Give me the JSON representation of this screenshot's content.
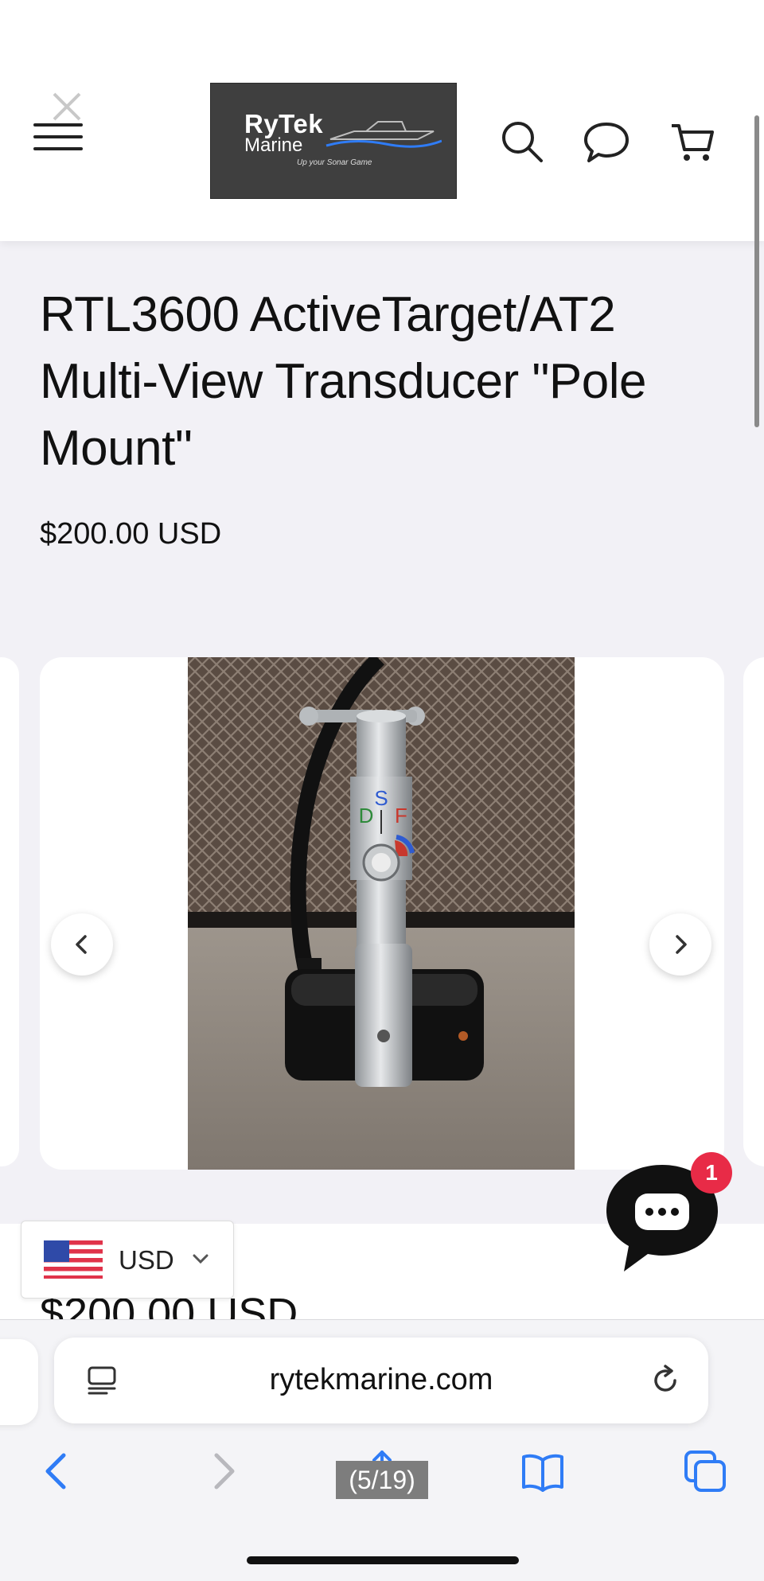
{
  "header": {
    "logo": {
      "line1": "RyTek",
      "line2": "Marine",
      "tagline": "Up your Sonar Game"
    }
  },
  "product": {
    "title": "RTL3600 ActiveTarget/AT2 Multi-View Transducer \"Pole Mount\"",
    "price": "$200.00 USD",
    "image_labels": {
      "s": "S",
      "d": "D",
      "f": "F"
    }
  },
  "sticky": {
    "price_peek": "$200.00 USD",
    "currency": "USD",
    "chat_badge": "1"
  },
  "browser": {
    "url": "rytekmarine.com",
    "page_counter": "(5/19)"
  },
  "colors": {
    "accent_badge": "#e82b47",
    "ios_blue": "#2f7cf6",
    "logo_bg": "#3f3f3f"
  }
}
